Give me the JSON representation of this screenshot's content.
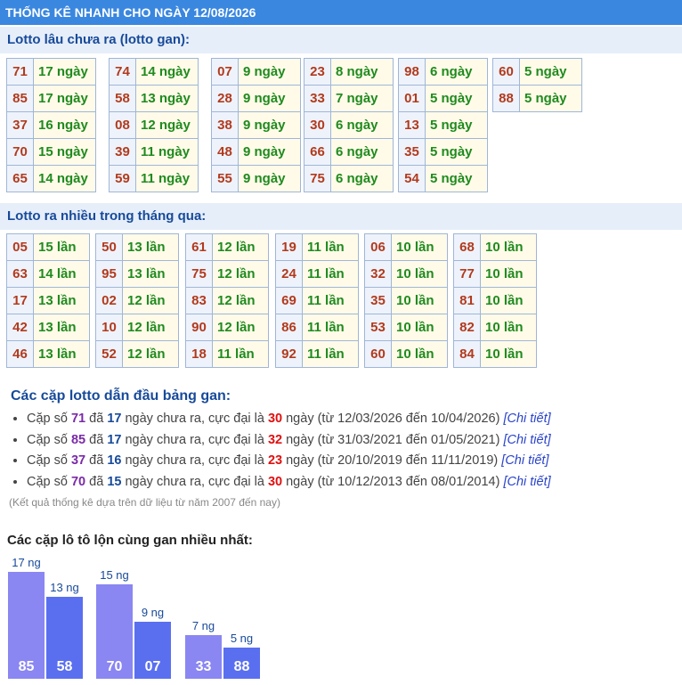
{
  "title": "THỐNG KÊ NHANH CHO NGÀY 12/08/2026",
  "section_gan": {
    "heading": "Lotto lâu chưa ra (lotto gan):",
    "groups": [
      [
        [
          "71",
          "17 ngày"
        ],
        [
          "85",
          "17 ngày"
        ],
        [
          "37",
          "16 ngày"
        ],
        [
          "70",
          "15 ngày"
        ],
        [
          "65",
          "14 ngày"
        ]
      ],
      [
        [
          "74",
          "14 ngày"
        ],
        [
          "58",
          "13 ngày"
        ],
        [
          "08",
          "12 ngày"
        ],
        [
          "39",
          "11 ngày"
        ],
        [
          "59",
          "11 ngày"
        ]
      ],
      [
        [
          "07",
          "9 ngày"
        ],
        [
          "28",
          "9 ngày"
        ],
        [
          "38",
          "9 ngày"
        ],
        [
          "48",
          "9 ngày"
        ],
        [
          "55",
          "9 ngày"
        ]
      ],
      [
        [
          "23",
          "8 ngày"
        ],
        [
          "33",
          "7 ngày"
        ],
        [
          "30",
          "6 ngày"
        ],
        [
          "66",
          "6 ngày"
        ],
        [
          "75",
          "6 ngày"
        ]
      ],
      [
        [
          "98",
          "6 ngày"
        ],
        [
          "01",
          "5 ngày"
        ],
        [
          "13",
          "5 ngày"
        ],
        [
          "35",
          "5 ngày"
        ],
        [
          "54",
          "5 ngày"
        ]
      ],
      [
        [
          "60",
          "5 ngày"
        ],
        [
          "88",
          "5 ngày"
        ]
      ]
    ]
  },
  "section_nhieu": {
    "heading": "Lotto ra nhiều trong tháng qua:",
    "groups": [
      [
        [
          "05",
          "15 lần"
        ],
        [
          "63",
          "14 lần"
        ],
        [
          "17",
          "13 lần"
        ],
        [
          "42",
          "13 lần"
        ],
        [
          "46",
          "13 lần"
        ]
      ],
      [
        [
          "50",
          "13 lần"
        ],
        [
          "95",
          "13 lần"
        ],
        [
          "02",
          "12 lần"
        ],
        [
          "10",
          "12 lần"
        ],
        [
          "52",
          "12 lần"
        ]
      ],
      [
        [
          "61",
          "12 lần"
        ],
        [
          "75",
          "12 lần"
        ],
        [
          "83",
          "12 lần"
        ],
        [
          "90",
          "12 lần"
        ],
        [
          "18",
          "11 lần"
        ]
      ],
      [
        [
          "19",
          "11 lần"
        ],
        [
          "24",
          "11 lần"
        ],
        [
          "69",
          "11 lần"
        ],
        [
          "86",
          "11 lần"
        ],
        [
          "92",
          "11 lần"
        ]
      ],
      [
        [
          "06",
          "10 lần"
        ],
        [
          "32",
          "10 lần"
        ],
        [
          "35",
          "10 lần"
        ],
        [
          "53",
          "10 lần"
        ],
        [
          "60",
          "10 lần"
        ]
      ],
      [
        [
          "68",
          "10 lần"
        ],
        [
          "77",
          "10 lần"
        ],
        [
          "81",
          "10 lần"
        ],
        [
          "82",
          "10 lần"
        ],
        [
          "84",
          "10 lần"
        ]
      ]
    ]
  },
  "pairs_heading": "Các cặp lotto dẫn đầu bảng gan:",
  "pairs_phrases": {
    "cap_so": "Cặp số",
    "da": "đã",
    "ngay_chua_ra": "ngày chưa ra, cực đại là",
    "ngay": "ngày",
    "tu": "(từ",
    "den": "đến",
    "close": ")",
    "link": "[Chi tiết]"
  },
  "pairs": [
    {
      "num": "71",
      "days": "17",
      "max": "30",
      "from": "12/03/2026",
      "to": "10/04/2026"
    },
    {
      "num": "85",
      "days": "17",
      "max": "32",
      "from": "31/03/2021",
      "to": "01/05/2021"
    },
    {
      "num": "37",
      "days": "16",
      "max": "23",
      "from": "20/10/2019",
      "to": "11/11/2019"
    },
    {
      "num": "70",
      "days": "15",
      "max": "30",
      "from": "10/12/2013",
      "to": "08/01/2014"
    }
  ],
  "note": "(Kết quả thống kê dựa trên dữ liệu từ năm 2007 đến nay)",
  "bar_heading": "Các cặp lô tô lộn cùng gan nhiều nhất:",
  "bar_pairs": [
    {
      "a": {
        "label": "85",
        "value": 17,
        "text": "17 ng"
      },
      "b": {
        "label": "58",
        "value": 13,
        "text": "13 ng"
      }
    },
    {
      "a": {
        "label": "70",
        "value": 15,
        "text": "15 ng"
      },
      "b": {
        "label": "07",
        "value": 9,
        "text": "9 ng"
      }
    },
    {
      "a": {
        "label": "33",
        "value": 7,
        "text": "7 ng"
      },
      "b": {
        "label": "88",
        "value": 5,
        "text": "5 ng"
      }
    }
  ],
  "colors": {
    "bar_primary": "#8a86f2",
    "bar_secondary": "#5a6ff0",
    "header": "#3a87e0"
  }
}
